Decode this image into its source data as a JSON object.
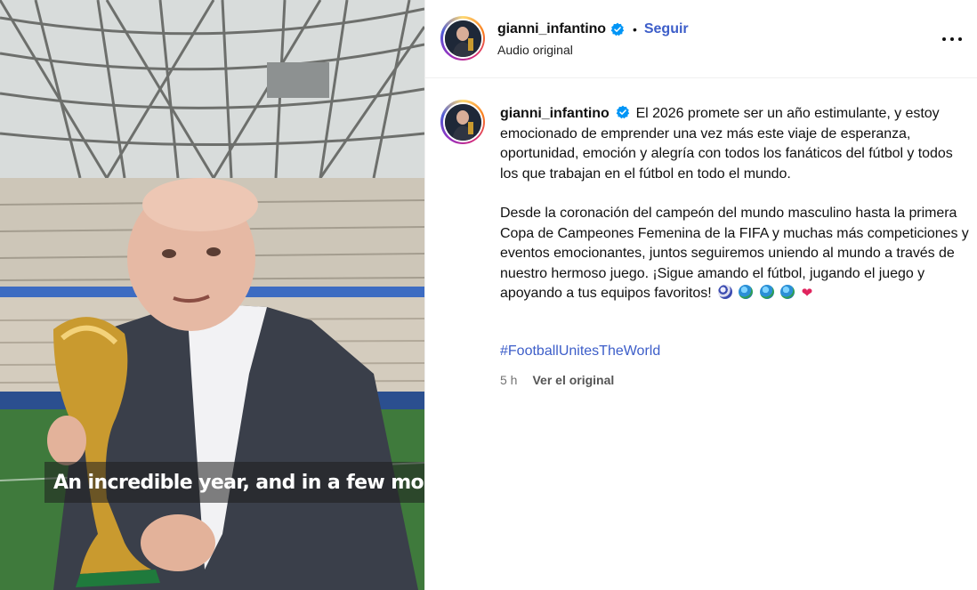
{
  "post": {
    "username": "gianni_infantino",
    "verified": true,
    "follow_label": "Seguir",
    "separator": "•",
    "audio_label": "Audio original",
    "more_icon": "more-horizontal-icon"
  },
  "media": {
    "caption": "An incredible year, and in a few months'"
  },
  "comment": {
    "username": "gianni_infantino",
    "paragraph1": "El 2026 promete ser un año estimulante, y estoy emocionado de emprender una vez más este viaje de esperanza, oportunidad, emoción y alegría con todos los fanáticos del fútbol y todos los que trabajan en el fútbol en todo el mundo.",
    "paragraph2": "Desde la coronación del campeón del mundo masculino hasta la primera Copa de Campeones Femenina de la FIFA y muchas más competiciones y eventos emocionantes, juntos seguiremos uniendo al mundo a través de nuestro hermoso juego. ¡Sigue amando el fútbol, jugando el juego y apoyando a tus equipos favoritos!",
    "emojis": [
      "soccer-ball",
      "globe",
      "globe",
      "globe",
      "heart"
    ],
    "heart_glyph": "❤",
    "hashtag": "#FootballUnitesTheWorld",
    "time": "5 h",
    "see_original": "Ver el original"
  },
  "colors": {
    "link": "#3d5ec9",
    "verified": "#0095f6",
    "muted": "#737373"
  }
}
